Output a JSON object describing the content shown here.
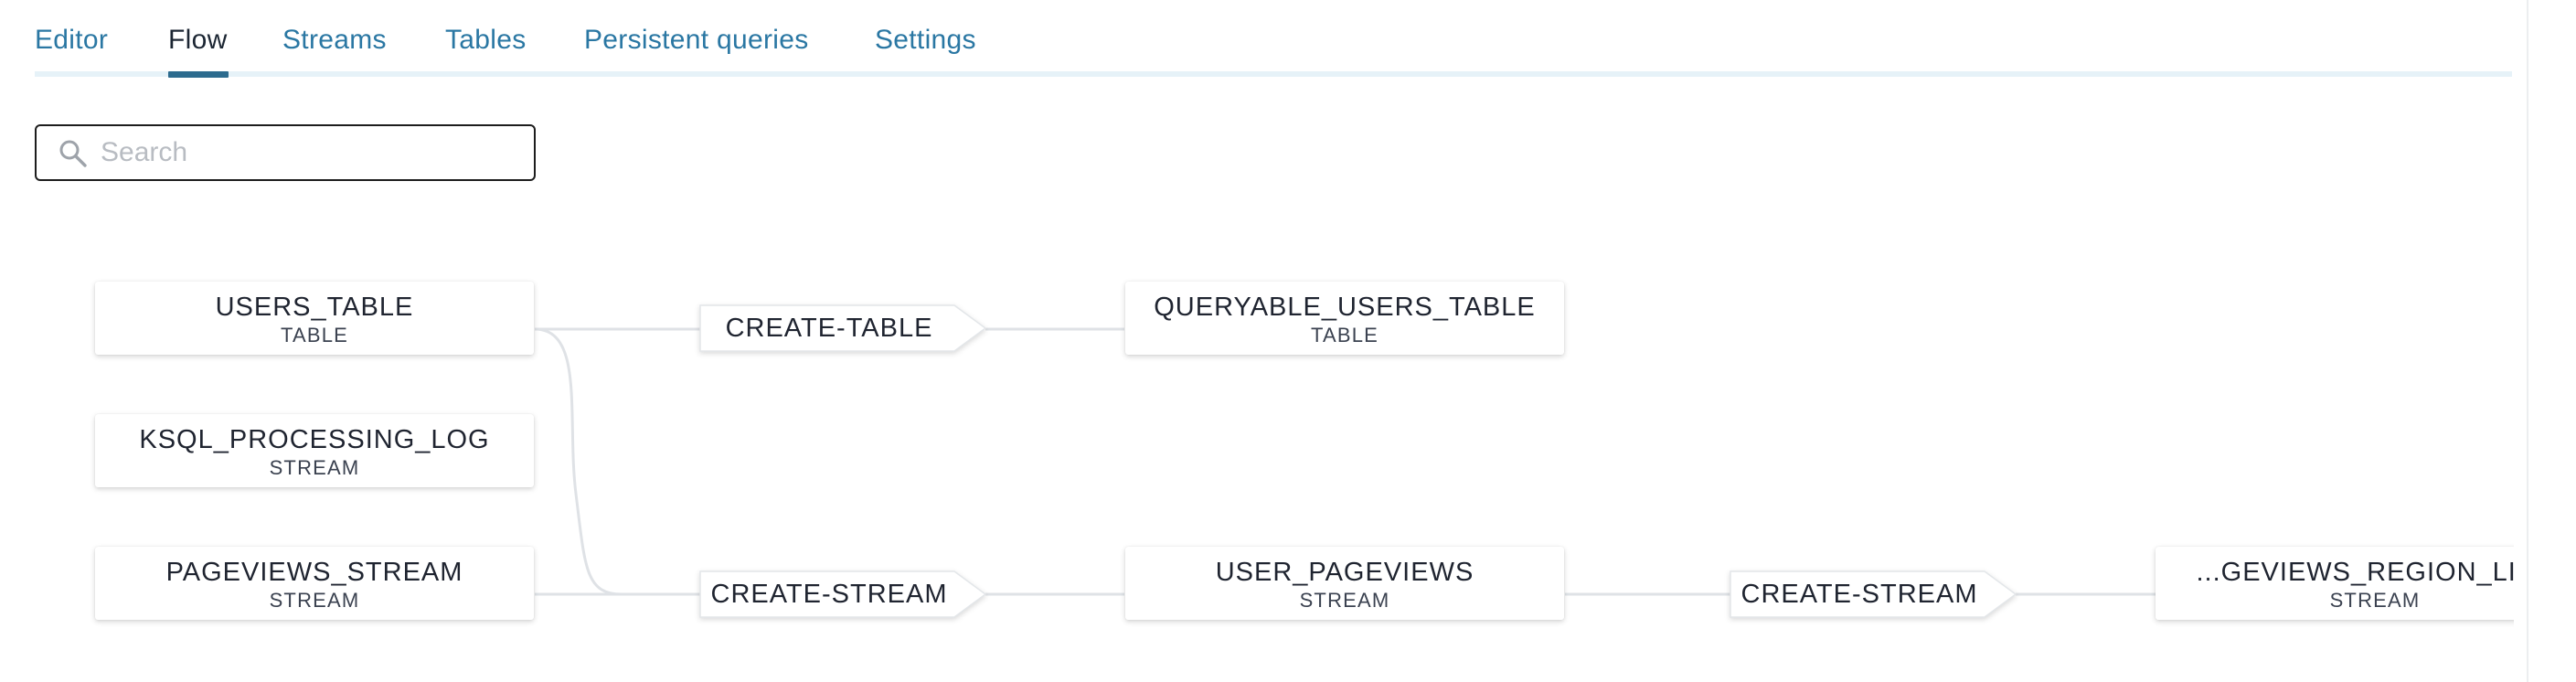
{
  "tabs": [
    {
      "label": "Editor",
      "active": false
    },
    {
      "label": "Flow",
      "active": true
    },
    {
      "label": "Streams",
      "active": false
    },
    {
      "label": "Tables",
      "active": false
    },
    {
      "label": "Persistent queries",
      "active": false
    },
    {
      "label": "Settings",
      "active": false
    }
  ],
  "search": {
    "placeholder": "Search",
    "value": "",
    "icon": "search-icon"
  },
  "flow": {
    "nodes": {
      "users_table": {
        "name": "USERS_TABLE",
        "type": "TABLE"
      },
      "ksql_processing_log": {
        "name": "KSQL_PROCESSING_LOG",
        "type": "STREAM"
      },
      "pageviews_stream": {
        "name": "PAGEVIEWS_STREAM",
        "type": "STREAM"
      },
      "queryable_users_table": {
        "name": "QUERYABLE_USERS_TABLE",
        "type": "TABLE"
      },
      "user_pageviews": {
        "name": "USER_PAGEVIEWS",
        "type": "STREAM"
      },
      "pageviews_region_like": {
        "name": "...GEVIEWS_REGION_LIKE",
        "type": "STREAM"
      }
    },
    "queries": {
      "create_table": {
        "label": "CREATE-TABLE"
      },
      "create_stream_1": {
        "label": "CREATE-STREAM"
      },
      "create_stream_2": {
        "label": "CREATE-STREAM"
      }
    }
  },
  "colors": {
    "tab_link": "#2a77a3",
    "tab_active": "#1c2633",
    "tab_indicator": "#2c6b8e",
    "edge": "#dfe2e6"
  }
}
